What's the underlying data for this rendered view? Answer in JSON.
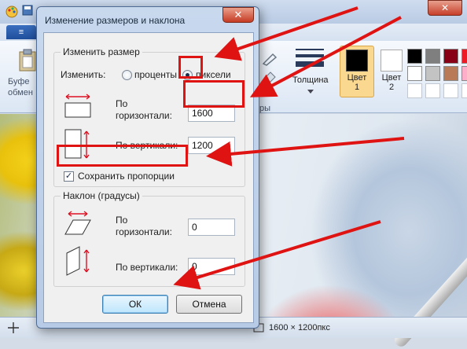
{
  "app": {
    "file_tab_label": "≡",
    "close_label": "✕",
    "ribbon": {
      "clipboard_label_line1": "Буфе",
      "clipboard_label_line2": "обмен",
      "shapes_group_partial": "ры",
      "thickness_label": "Толщина",
      "color1_label": "Цвет",
      "color1_num": "1",
      "color2_label": "Цвет",
      "color2_num": "2",
      "color1_value": "#000000",
      "color2_value": "#ffffff",
      "palette_row1": [
        "#000000",
        "#7f7f7f",
        "#880015",
        "#ed1c24",
        "#ff7f27"
      ],
      "palette_row2": [
        "#ffffff",
        "#c3c3c3",
        "#b97a57",
        "#ffaec9",
        "#ffc90e"
      ]
    },
    "status_bar": {
      "image_size": "1600 × 1200пкс"
    }
  },
  "dialog": {
    "title": "Изменение размеров и наклона",
    "close_label": "✕",
    "resize_group": {
      "legend": "Изменить размер",
      "by_label": "Изменить:",
      "percent_label": "проценты",
      "pixels_label": "пиксели",
      "selected": "pixels",
      "horizontal_label_line1": "По",
      "horizontal_label_line2": "горизонтали:",
      "horizontal_value": "1600",
      "vertical_label": "По вертикали:",
      "vertical_value": "1200",
      "keep_ratio_label": "Сохранить пропорции",
      "keep_ratio_checked": true,
      "check_mark": "✓"
    },
    "skew_group": {
      "legend": "Наклон (градусы)",
      "horizontal_label_line1": "По",
      "horizontal_label_line2": "горизонтали:",
      "horizontal_value": "0",
      "vertical_label": "По вертикали:",
      "vertical_value": "0"
    },
    "buttons": {
      "ok": "ОК",
      "cancel": "Отмена"
    }
  },
  "annotation": {
    "color": "#e01313"
  }
}
